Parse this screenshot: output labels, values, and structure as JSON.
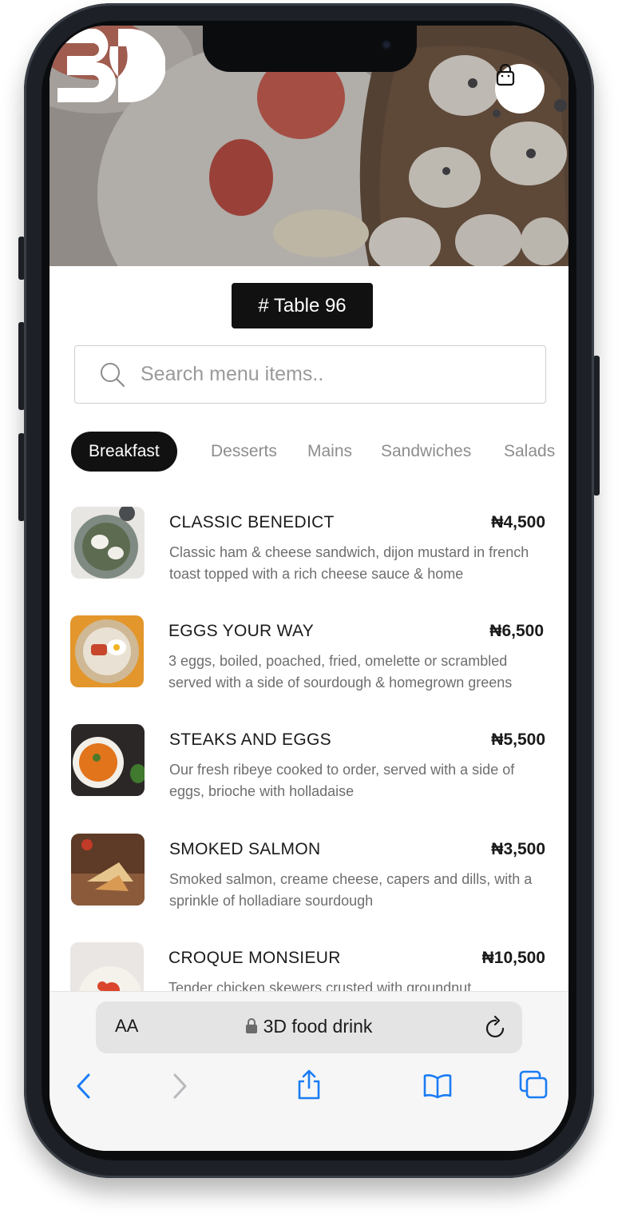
{
  "table": {
    "label": "# Table 96"
  },
  "search": {
    "placeholder": "Search menu items.."
  },
  "categories": [
    {
      "label": "Breakfast",
      "active": true
    },
    {
      "label": "Desserts",
      "active": false
    },
    {
      "label": "Mains",
      "active": false
    },
    {
      "label": "Sandwiches",
      "active": false
    },
    {
      "label": "Salads",
      "active": false
    }
  ],
  "menu_items": [
    {
      "name": "CLASSIC BENEDICT",
      "price": "₦4,500",
      "description": "Classic ham & cheese sandwich, dijon mustard in french toast topped with a rich cheese sauce & home"
    },
    {
      "name": "EGGS YOUR WAY",
      "price": "₦6,500",
      "description": "3 eggs, boiled, poached, fried, omelette or scrambled served with a side of sourdough & homegrown greens"
    },
    {
      "name": "STEAKS AND EGGS",
      "price": "₦5,500",
      "description": "Our fresh ribeye cooked to order, served with a side of eggs, brioche with holladaise"
    },
    {
      "name": "SMOKED SALMON",
      "price": "₦3,500",
      "description": "Smoked salmon, creame cheese, capers and dills, with a sprinkle of holladiare sourdough"
    },
    {
      "name": "CROQUE MONSIEUR",
      "price": "₦10,500",
      "description": "Tender chicken skewers crusted with groundnut"
    }
  ],
  "browser": {
    "text_size_label": "AA",
    "url": "3D food drink"
  },
  "icons": {
    "cart": "shopping-bag-icon",
    "search": "search-icon",
    "lock": "lock-icon",
    "reload": "reload-icon",
    "back": "chevron-left-icon",
    "forward": "chevron-right-icon",
    "share": "share-icon",
    "bookmarks": "book-icon",
    "tabs": "tabs-icon"
  },
  "colors": {
    "accent": "#111111",
    "browser_blue": "#1a7cf4"
  }
}
